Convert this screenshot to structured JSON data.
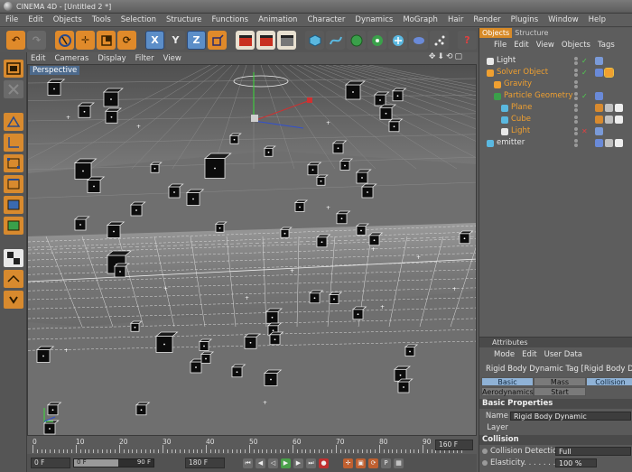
{
  "window": {
    "title": "CINEMA 4D - [Untitled 2 *]"
  },
  "menu": [
    "File",
    "Edit",
    "Objects",
    "Tools",
    "Selection",
    "Structure",
    "Functions",
    "Animation",
    "Character",
    "Dynamics",
    "MoGraph",
    "Hair",
    "Render",
    "Plugins",
    "Window",
    "Help"
  ],
  "toolbar": {
    "x_label": "X",
    "y_label": "Y",
    "z_label": "Z"
  },
  "viewport": {
    "menu": [
      "Edit",
      "Cameras",
      "Display",
      "Filter",
      "View"
    ],
    "nav_icons": "✥⬇⟲▢",
    "label": "Perspective"
  },
  "timeline": {
    "ticks": [
      "0",
      "10",
      "20",
      "30",
      "40",
      "50",
      "60",
      "70",
      "80",
      "90"
    ],
    "end_frame": "160 F",
    "current_frame": "0 F",
    "range_start": "0 F",
    "range_end": "90 F",
    "range_fraction": 0.56,
    "max_frame": "180 F"
  },
  "object_manager": {
    "tabs": [
      "Objects",
      "Structure"
    ],
    "menu": [
      "File",
      "Edit",
      "View",
      "Objects",
      "Tags"
    ],
    "items": [
      {
        "name": "Light",
        "indent": 0,
        "color": "white",
        "icon": "light-icon",
        "check": "✓",
        "tags": [
          "light-tag"
        ]
      },
      {
        "name": "Solver Object",
        "indent": 0,
        "color": "orange",
        "icon": "solver-icon",
        "check": "✓",
        "tags": [
          "rigid-body-tag",
          "selected-tag"
        ]
      },
      {
        "name": "Gravity",
        "indent": 1,
        "color": "orange",
        "icon": "gravity-icon",
        "check": "",
        "tags": []
      },
      {
        "name": "Particle Geometry",
        "indent": 1,
        "color": "orange",
        "icon": "particle-icon",
        "check": "✓",
        "tags": [
          "rigid-body-tag"
        ]
      },
      {
        "name": "Plane",
        "indent": 2,
        "color": "orange",
        "icon": "plane-icon",
        "check": "",
        "tags": [
          "material-tag",
          "phong-tag",
          "checker-tag"
        ]
      },
      {
        "name": "Cube",
        "indent": 2,
        "color": "orange",
        "icon": "cube-icon",
        "check": "",
        "tags": [
          "material-tag",
          "phong-tag",
          "checker-tag"
        ]
      },
      {
        "name": "Light",
        "indent": 2,
        "color": "orange",
        "icon": "light-icon",
        "check": "✕",
        "tags": [
          "light-tag"
        ]
      },
      {
        "name": "emitter",
        "indent": 0,
        "color": "white",
        "icon": "emitter-icon",
        "check": "",
        "tags": [
          "rigid-body-tag",
          "phong-tag",
          "checker-tag"
        ]
      }
    ]
  },
  "attributes": {
    "header": "Attributes",
    "menu": [
      "Mode",
      "Edit",
      "User Data"
    ],
    "object_title": "Rigid Body Dynamic Tag [Rigid Body Dy",
    "tabs": [
      "Basic",
      "Mass",
      "Collision",
      "Aerodynamics",
      "Start"
    ],
    "section_basic": "Basic Properties",
    "name_label": "Name",
    "name_value": "Rigid Body Dynamic",
    "layer_label": "Layer",
    "layer_value": "",
    "section_collision": "Collision",
    "collision_detection_label": "Collision Detection",
    "collision_detection_value": "Full",
    "elasticity_label": "Elasticity. . . . . . . .",
    "elasticity_value": "100 %"
  },
  "colors": {
    "accent": "#d78a28",
    "tab_active": "#8fb2d6",
    "orange_text": "#f0a030",
    "check_green": "#4fd04f"
  }
}
